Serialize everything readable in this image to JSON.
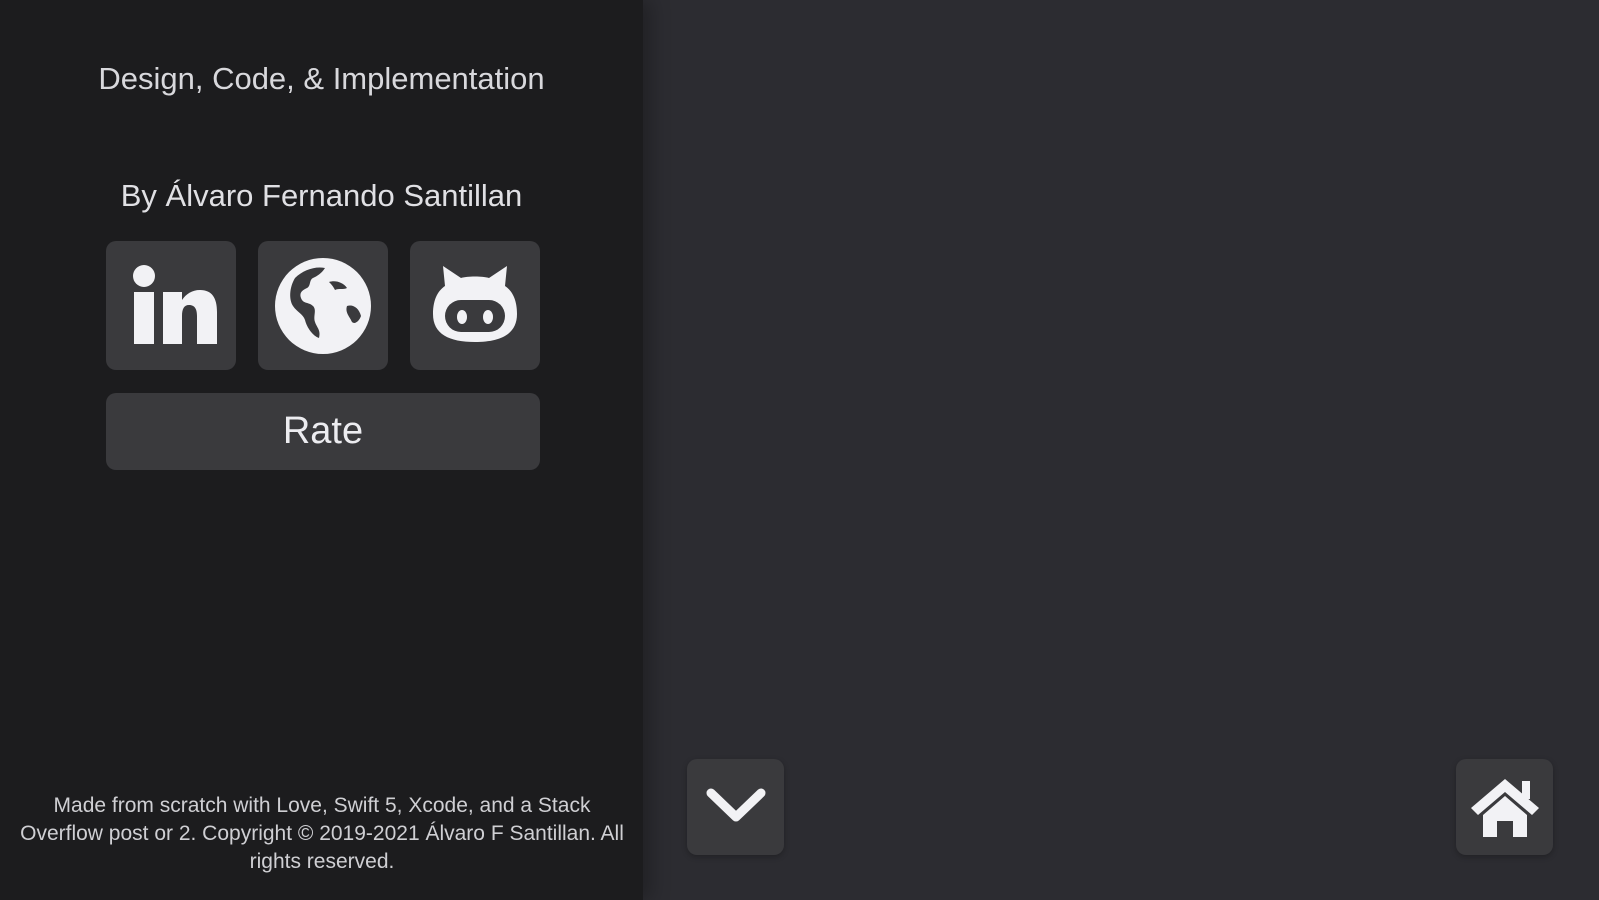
{
  "sidebar": {
    "title": "Design, Code, & Implementation",
    "author": "By Álvaro Fernando Santillan",
    "social_links": [
      {
        "icon": "linkedin-icon"
      },
      {
        "icon": "globe-icon"
      },
      {
        "icon": "github-icon"
      }
    ],
    "rate_label": "Rate",
    "footer": "Made from scratch with Love, Swift 5, Xcode, and a Stack Overflow post or 2. Copyright © 2019-2021 Álvaro F Santillan. All rights reserved."
  },
  "controls": {
    "collapse_icon": "chevron-down-icon",
    "home_icon": "home-icon"
  },
  "colors": {
    "sidebar_bg": "#1c1c1e",
    "main_bg": "#2c2c31",
    "tile_bg": "#3a3a3d",
    "text": "#e0e0e4"
  }
}
